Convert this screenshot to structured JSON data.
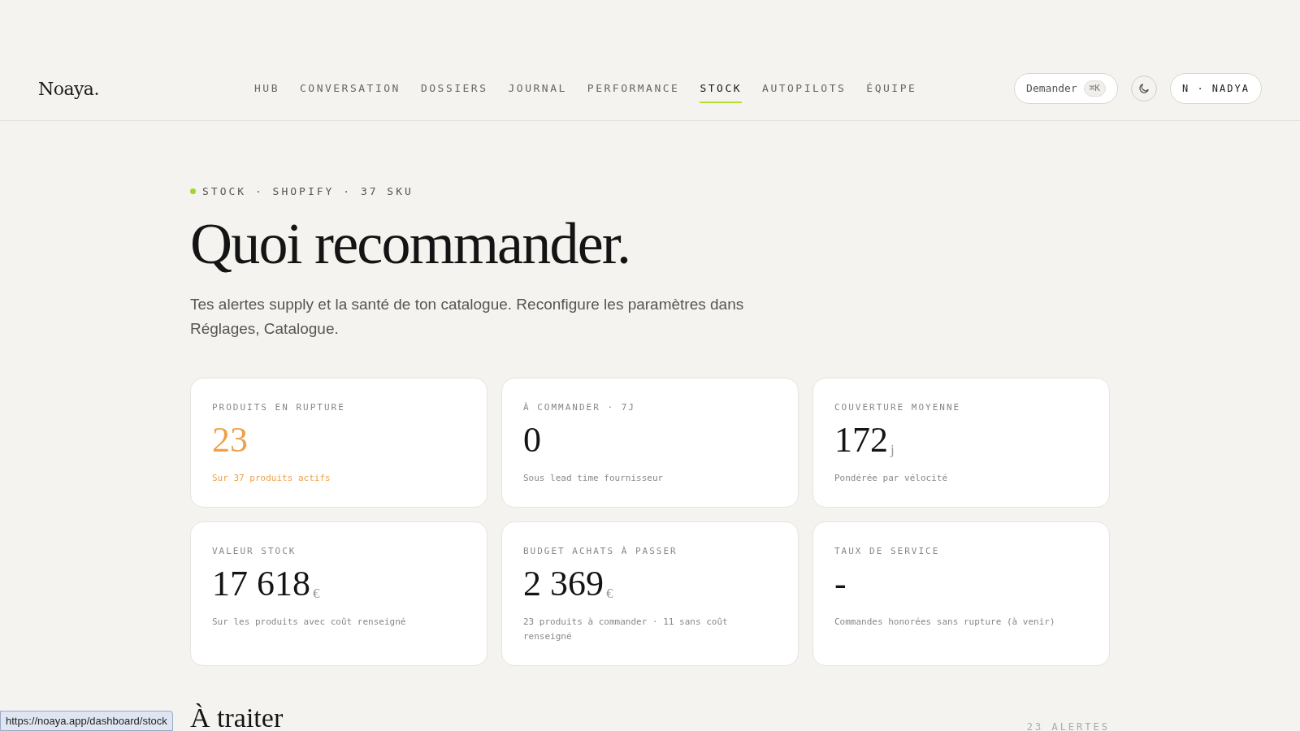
{
  "header": {
    "logo": "Noaya.",
    "nav": [
      {
        "label": "HUB",
        "selected": false
      },
      {
        "label": "CONVERSATION",
        "selected": false
      },
      {
        "label": "DOSSIERS",
        "selected": false
      },
      {
        "label": "JOURNAL",
        "selected": false
      },
      {
        "label": "PERFORMANCE",
        "selected": false
      },
      {
        "label": "STOCK",
        "selected": true
      },
      {
        "label": "AUTOPILOTS",
        "selected": false
      },
      {
        "label": "ÉQUIPE",
        "selected": false
      }
    ],
    "ask_button": {
      "label": "Demander",
      "shortcut": "⌘K"
    },
    "user_button": "N · NADYA"
  },
  "eyebrow": "STOCK · SHOPIFY · 37 SKU",
  "title": "Quoi recommander.",
  "intro": "Tes alertes supply et la santé de ton catalogue. Reconfigure les paramètres dans Réglages, Catalogue.",
  "cards": [
    {
      "label": "PRODUITS EN RUPTURE",
      "value": "23",
      "note": "Sur 37 produits actifs",
      "alert": true
    },
    {
      "label": "À COMMANDER · 7J",
      "value": "0",
      "note": "Sous lead time fournisseur",
      "alert": false
    },
    {
      "label": "COUVERTURE MOYENNE",
      "value": "172",
      "unit": "j",
      "note": "Pondérée par vélocité",
      "alert": false
    },
    {
      "label": "VALEUR STOCK",
      "value": "17 618",
      "unit": "€",
      "note": "Sur les produits avec coût renseigné",
      "alert": false
    },
    {
      "label": "BUDGET ACHATS À PASSER",
      "value": "2 369",
      "unit": "€",
      "note": "23 produits à commander · 11 sans coût renseigné",
      "alert": false
    },
    {
      "label": "TAUX DE SERVICE",
      "value": "-",
      "note": "Commandes honorées sans rupture (à venir)",
      "alert": false
    }
  ],
  "section": {
    "title": "À traiter",
    "count": "23 ALERTES"
  },
  "status_bar": "https://noaya.app/dashboard/stock"
}
